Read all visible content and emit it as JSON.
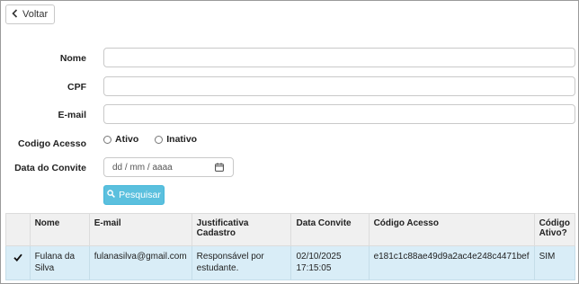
{
  "toolbar": {
    "back_label": "Voltar"
  },
  "form": {
    "nome_label": "Nome",
    "cpf_label": "CPF",
    "email_label": "E-mail",
    "codigo_label": "Codigo Acesso",
    "radio_ativo": "Ativo",
    "radio_inativo": "Inativo",
    "data_label": "Data do Convite",
    "date_placeholder": "dd / mm / aaaa",
    "search_label": "Pesquisar"
  },
  "table": {
    "headers": [
      "",
      "Nome",
      "E-mail",
      "Justificativa Cadastro",
      "Data Convite",
      "Código Acesso",
      "Código Ativo?"
    ],
    "rows": [
      {
        "nome": "Fulana da Silva",
        "email": "fulanasilva@gmail.com",
        "justificativa": "Responsável por estudante.",
        "data": "02/10/2025 17:15:05",
        "codigo": "e181c1c88ae49d9a2ac4e248c4471bef",
        "ativo": "SIM"
      }
    ]
  },
  "colors": {
    "search_button": "#5bc0de",
    "selected_row": "#d9edf7",
    "header_bg": "#f0f0f0"
  },
  "icons": {
    "back": "chevron-left-icon",
    "calendar": "calendar-icon",
    "search": "search-icon",
    "row_check": "check-icon"
  }
}
